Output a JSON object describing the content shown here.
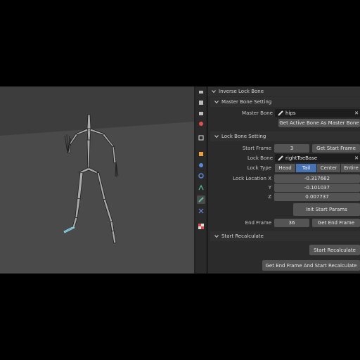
{
  "panel": {
    "title": "Inverse Lock Bone",
    "master": {
      "header": "Master Bone Setting",
      "label": "Master Bone",
      "value": "hips",
      "get_button": "Get Active Bone As Master Bone"
    },
    "lock": {
      "header": "Lock Bone Setting",
      "start_frame_label": "Start Frame",
      "start_frame_value": "3",
      "get_start_button": "Get Start Frame",
      "lock_bone_label": "Lock Bone",
      "lock_bone_value": "rightToeBase",
      "lock_type_label": "Lock Type",
      "lock_type_options": [
        "Head",
        "Tail",
        "Center",
        "Entire"
      ],
      "lock_type_selected": "Tail",
      "loc_x_label": "Lock Location X",
      "loc_x_value": "-0.317662",
      "loc_y_label": "Y",
      "loc_y_value": "-0.101037",
      "loc_z_label": "Z",
      "loc_z_value": "0.007737",
      "init_button": "Init Start Params",
      "end_frame_label": "End Frame",
      "end_frame_value": "36",
      "get_end_button": "Get End Frame"
    },
    "recalc": {
      "header": "Start Recalculate",
      "start_button": "Start Recalculate",
      "end_and_start_button": "Get End Frame And Start Recalculate"
    }
  },
  "colors": {
    "accent": "#4772b3",
    "selected_bone": "#5fb0c8",
    "viewport_bg": "#3d3d3d",
    "ground": "#4a4a4a"
  },
  "icons": [
    "tool-icon",
    "render-icon",
    "output-icon",
    "view-layer-icon",
    "scene-icon",
    "world-icon",
    "collection-icon",
    "object-icon",
    "modifiers-icon",
    "particles-icon",
    "physics-icon",
    "constraints-icon",
    "object-data-icon",
    "bone-icon",
    "bone-constraint-icon",
    "texture-icon"
  ]
}
